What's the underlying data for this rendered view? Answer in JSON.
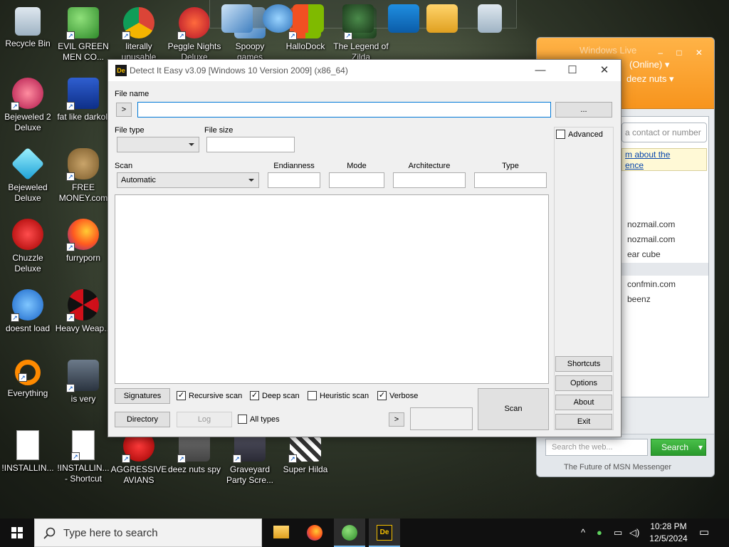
{
  "desktop": {
    "icons": [
      {
        "label": "Recycle Bin"
      },
      {
        "label": "EVIL GREEN MEN CO..."
      },
      {
        "label": "literally unusable"
      },
      {
        "label": "Peggle Nights Deluxe"
      },
      {
        "label": "Spoopy games"
      },
      {
        "label": "HalloDock"
      },
      {
        "label": "The Legend of Zilda"
      },
      {
        "label": "Bejeweled 2 Deluxe"
      },
      {
        "label": "fat like darkoli"
      },
      {
        "label": "Bejeweled Deluxe"
      },
      {
        "label": "FREE MONEY.com"
      },
      {
        "label": "Chuzzle Deluxe"
      },
      {
        "label": "furryporn"
      },
      {
        "label": "doesnt load"
      },
      {
        "label": "Heavy Weap..."
      },
      {
        "label": "Everything"
      },
      {
        "label": "is very"
      },
      {
        "label": "!INSTALLIN..."
      },
      {
        "label": "!INSTALLIN... - Shortcut"
      },
      {
        "label": "AGGRESSIVE AVIANS"
      },
      {
        "label": "deez nuts spy"
      },
      {
        "label": "Graveyard Party Scre..."
      },
      {
        "label": "Super Hilda"
      }
    ]
  },
  "wlm": {
    "title": "Windows Live",
    "status": "(Online)",
    "message": "deez nuts",
    "search_contacts_placeholder": "a contact or number",
    "news": "m about the",
    "news2": "ence",
    "contacts": [
      "nozmail.com",
      "nozmail.com",
      "ear cube",
      "confmin.com",
      "beenz"
    ],
    "web_search_placeholder": "Search the web...",
    "search_button": "Search",
    "footer": "The Future of MSN Messenger"
  },
  "die": {
    "title": "Detect It Easy v3.09 [Windows 10 Version 2009] (x86_64)",
    "file_name_label": "File name",
    "arrow_button": ">",
    "browse_button": "...",
    "file_type_label": "File type",
    "file_size_label": "File size",
    "advanced_label": "Advanced",
    "scan_label": "Scan",
    "scan_value": "Automatic",
    "endianness_label": "Endianness",
    "mode_label": "Mode",
    "architecture_label": "Architecture",
    "type_label": "Type",
    "shortcuts_button": "Shortcuts",
    "options_button": "Options",
    "about_button": "About",
    "exit_button": "Exit",
    "signatures_button": "Signatures",
    "recursive_scan": "Recursive scan",
    "deep_scan": "Deep scan",
    "heuristic_scan": "Heuristic scan",
    "verbose": "Verbose",
    "directory_button": "Directory",
    "log_button": "Log",
    "all_types": "All types",
    "scan_button": "Scan",
    "check_mark": "✓"
  },
  "taskbar": {
    "search_placeholder": "Type here to search",
    "time": "10:28 PM",
    "date": "12/5/2024"
  }
}
